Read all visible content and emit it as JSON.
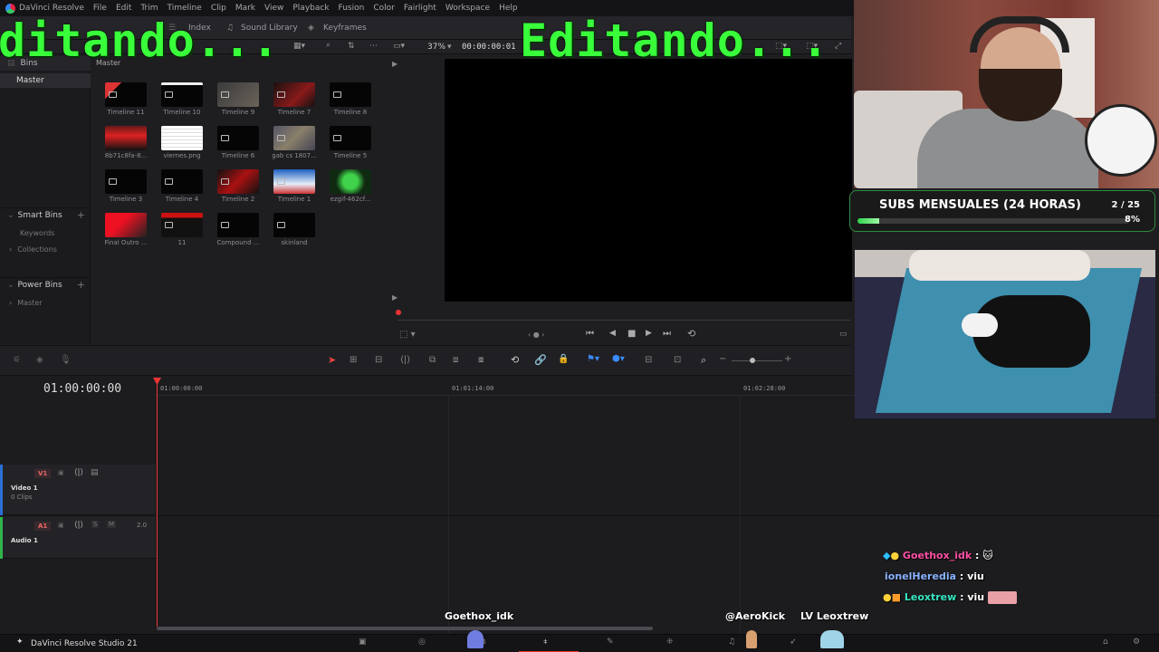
{
  "menu": {
    "app_name": "DaVinci Resolve",
    "items": [
      "File",
      "Edit",
      "Trim",
      "Timeline",
      "Clip",
      "Mark",
      "View",
      "Playback",
      "Fusion",
      "Color",
      "Fairlight",
      "Workspace",
      "Help"
    ]
  },
  "toolbar": {
    "index_label": "Index",
    "sound_library_label": "Sound Library",
    "keyframes_label": "Keyframes",
    "zoom": "37%",
    "viewer_timecode": "00:00:00:01"
  },
  "overlay": {
    "left_text": "ditando...",
    "right_text": "Editando..."
  },
  "bins": {
    "header": "Bins",
    "master": "Master",
    "smart_bins": "Smart Bins",
    "keywords": "Keywords",
    "collections": "Collections",
    "power_bins": "Power Bins",
    "power_master": "Master"
  },
  "media": {
    "header": "Master",
    "clips": [
      "Timeline 11",
      "Timeline 10",
      "Timeline 9",
      "Timeline 7",
      "Timeline 8",
      "8b71c8fa-8...",
      "viernes.png",
      "Timeline 6",
      "gab cs 1807...",
      "Timeline 5",
      "Timeline 3",
      "Timeline 4",
      "Timeline 2",
      "Timeline 1",
      "ezgif-462cf...",
      "Final Outro ...",
      "11",
      "Compound ...",
      "skinland"
    ]
  },
  "timeline": {
    "timecode": "01:00:00:00",
    "ruler": [
      "01:00:00:00",
      "01:01:14:00",
      "01:02:28:00"
    ],
    "video_track_id": "V1",
    "video_track_name": "Video 1",
    "video_track_clips": "0 Clips",
    "audio_track_id": "A1",
    "audio_track_name": "Audio 1",
    "audio_solo": "S",
    "audio_mute": "M",
    "audio_level": "2.0"
  },
  "bottom": {
    "app_label": "DaVinci Resolve Studio 21"
  },
  "stream": {
    "subs_title": "SUBS MENSUALES (24 HORAS)",
    "subs_count": "2 / 25",
    "subs_percent": "8%",
    "subs_progress": 0.08,
    "chat": [
      {
        "user": "Goethox_idk",
        "message": ":",
        "color": "#ff4fa3"
      },
      {
        "user": "ionelHeredia",
        "message": ": viu",
        "color": "#8ab4ff"
      },
      {
        "user": "Leoxtrew",
        "message": ": viu",
        "color": "#37e6c0"
      }
    ],
    "tags": [
      "Goethox_idk",
      "@AeroKick",
      "LV Leoxtrew"
    ]
  },
  "colors": {
    "overlay_green": "#39ff3a",
    "playhead": "#e33333",
    "progress_green": "#2fd34a"
  }
}
